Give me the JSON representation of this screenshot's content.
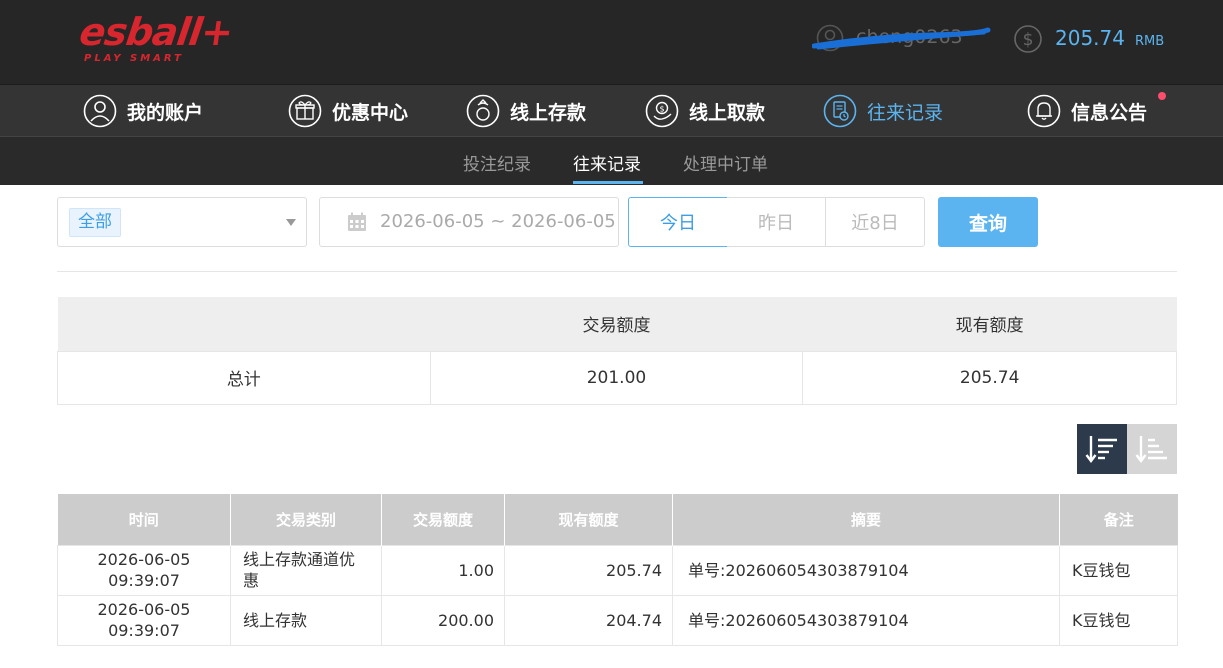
{
  "header": {
    "logo_main": "esball+",
    "logo_sub": "PLAY SMART",
    "username": "cheng0263",
    "balance_amount": "205.74",
    "balance_unit": "RMB"
  },
  "main_nav": [
    {
      "label": "我的账户",
      "icon": "user-icon"
    },
    {
      "label": "优惠中心",
      "icon": "gift-icon"
    },
    {
      "label": "线上存款",
      "icon": "deposit-icon"
    },
    {
      "label": "线上取款",
      "icon": "withdraw-icon"
    },
    {
      "label": "往来记录",
      "icon": "records-icon",
      "active": true
    },
    {
      "label": "信息公告",
      "icon": "bell-icon"
    }
  ],
  "sub_nav": [
    {
      "label": "投注纪录"
    },
    {
      "label": "往来记录",
      "active": true
    },
    {
      "label": "处理中订单"
    }
  ],
  "filter": {
    "type_selected": "全部",
    "date_range": "2026-06-05 ~ 2026-06-05",
    "quick_buttons": [
      "今日",
      "昨日",
      "近8日"
    ],
    "query_label": "查询"
  },
  "summary": {
    "headers": [
      "",
      "交易额度",
      "现有额度"
    ],
    "row": [
      "总计",
      "201.00",
      "205.74"
    ]
  },
  "records": {
    "headers": [
      "时间",
      "交易类别",
      "交易额度",
      "现有额度",
      "摘要",
      "备注"
    ],
    "rows": [
      [
        "2026-06-05 09:39:07",
        "线上存款通道优惠",
        "1.00",
        "205.74",
        "单号:202606054303879104",
        "K豆钱包"
      ],
      [
        "2026-06-05 09:39:07",
        "线上存款",
        "200.00",
        "204.74",
        "单号:202606054303879104",
        "K豆钱包"
      ]
    ]
  },
  "colors": {
    "accent": "#5bb4f0",
    "topbar": "#262626",
    "logo": "#d8262f",
    "sort_active": "#2c3a4c"
  }
}
